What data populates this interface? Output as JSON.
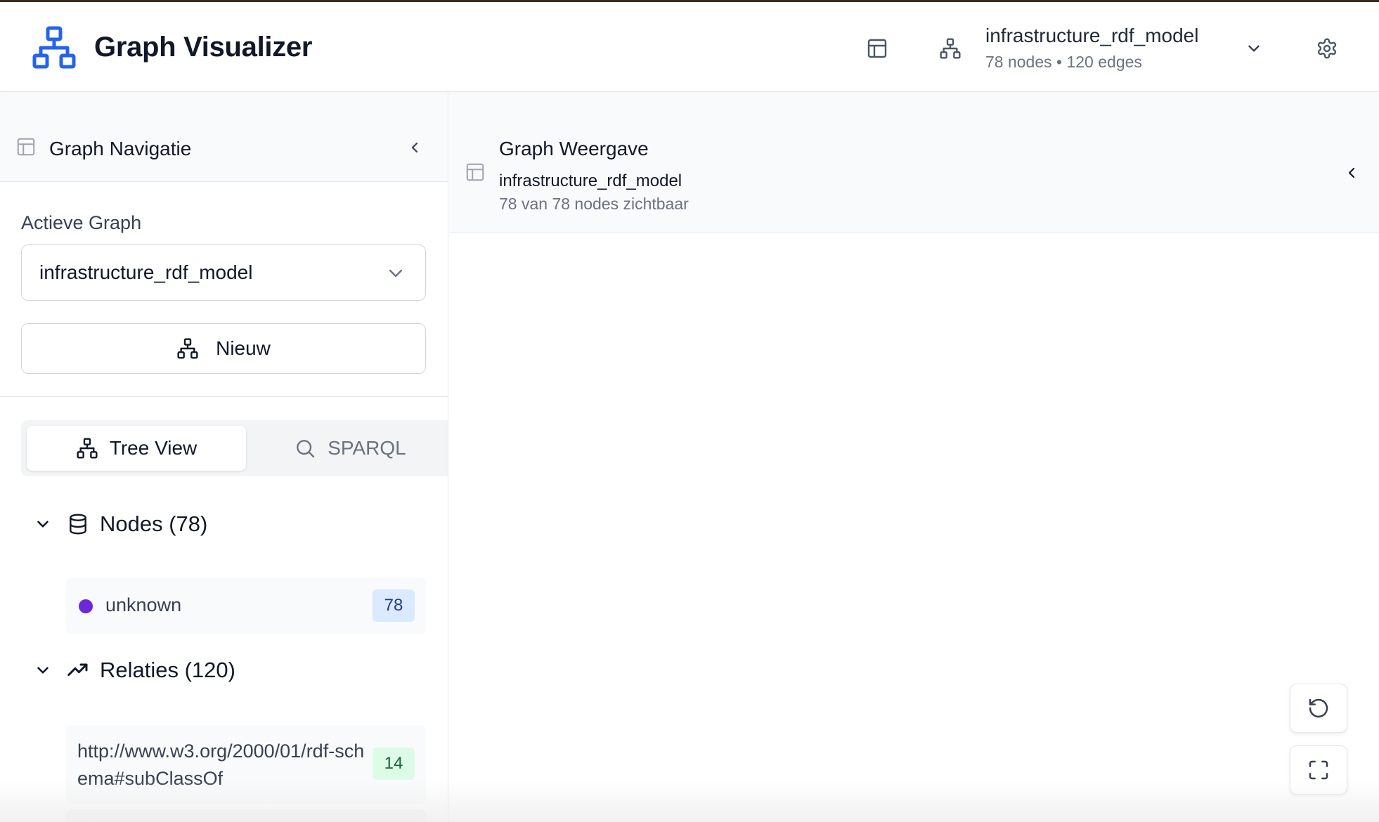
{
  "header": {
    "app_title": "Graph Visualizer",
    "graph_name": "infrastructure_rdf_model",
    "graph_stats": "78 nodes • 120 edges"
  },
  "sidebar": {
    "title": "Graph Navigatie",
    "active_graph_label": "Actieve Graph",
    "active_graph_value": "infrastructure_rdf_model",
    "new_button_label": "Nieuw",
    "tabs": [
      {
        "label": "Tree View",
        "active": true
      },
      {
        "label": "SPARQL",
        "active": false
      }
    ],
    "nodes_section": {
      "title": "Nodes (78)",
      "items": [
        {
          "label": "unknown",
          "count": "78",
          "color": "#6d28d9"
        }
      ]
    },
    "relations_section": {
      "title": "Relaties (120)",
      "items": [
        {
          "label": "http://www.w3.org/2000/01/rdf-schema#subClassOf",
          "count": "14"
        }
      ]
    }
  },
  "main": {
    "title": "Graph Weergave",
    "graph_name": "infrastructure_rdf_model",
    "visible_text": "78 van 78 nodes zichtbaar"
  },
  "colors": {
    "accent": "#2563eb",
    "node_badge_bg": "#dbeafe",
    "relation_badge_bg": "#dcfce7"
  }
}
